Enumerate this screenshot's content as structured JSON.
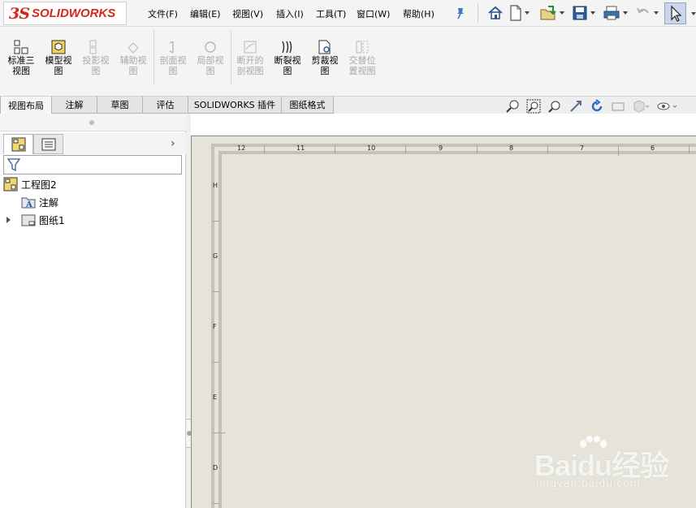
{
  "app": {
    "logo_ds": "3S",
    "logo_text": "SOLIDWORKS"
  },
  "menu": [
    {
      "label": "文件(F)"
    },
    {
      "label": "编辑(E)"
    },
    {
      "label": "视图(V)"
    },
    {
      "label": "插入(I)"
    },
    {
      "label": "工具(T)"
    },
    {
      "label": "窗口(W)"
    },
    {
      "label": "帮助(H)"
    }
  ],
  "quick_access": [
    "home-icon",
    "new-document-icon",
    "open-icon",
    "save-icon",
    "print-icon",
    "undo-icon",
    "select-icon"
  ],
  "commands": [
    {
      "label_line1": "标准三",
      "label_line2": "视图",
      "enabled": true
    },
    {
      "label_line1": "模型视",
      "label_line2": "图",
      "enabled": true
    },
    {
      "label_line1": "投影视",
      "label_line2": "图",
      "enabled": false
    },
    {
      "label_line1": "辅助视",
      "label_line2": "图",
      "enabled": false
    },
    {
      "label_line1": "剖面视",
      "label_line2": "图",
      "enabled": false
    },
    {
      "label_line1": "局部视",
      "label_line2": "图",
      "enabled": false
    },
    {
      "label_line1": "断开的",
      "label_line2": "剖视图",
      "enabled": false
    },
    {
      "label_line1": "断裂视",
      "label_line2": "图",
      "enabled": true
    },
    {
      "label_line1": "剪裁视",
      "label_line2": "图",
      "enabled": true
    },
    {
      "label_line1": "交替位",
      "label_line2": "置视图",
      "enabled": false
    }
  ],
  "tabs": [
    {
      "label": "视图布局",
      "active": true
    },
    {
      "label": "注解",
      "active": false
    },
    {
      "label": "草图",
      "active": false
    },
    {
      "label": "评估",
      "active": false
    },
    {
      "label": "SOLIDWORKS 插件",
      "active": false
    },
    {
      "label": "图纸格式",
      "active": false
    }
  ],
  "tree": {
    "root": "工程图2",
    "items": [
      {
        "label": "注解",
        "icon": "annotation-folder-icon"
      },
      {
        "label": "图纸1",
        "icon": "sheet-icon"
      }
    ]
  },
  "sheet": {
    "column_numbers": [
      "12",
      "11",
      "10",
      "9",
      "8",
      "7",
      "6"
    ],
    "row_letters": [
      "H",
      "G",
      "F",
      "E",
      "D"
    ]
  },
  "watermark": {
    "main": "Baidu经验",
    "url": "jingyan.baidu.com"
  },
  "colors": {
    "accent_red": "#d9261c",
    "sheet_bg": "#e6e4d8",
    "border": "#c4c2b8",
    "selected_blue": "#c9d7e8"
  }
}
